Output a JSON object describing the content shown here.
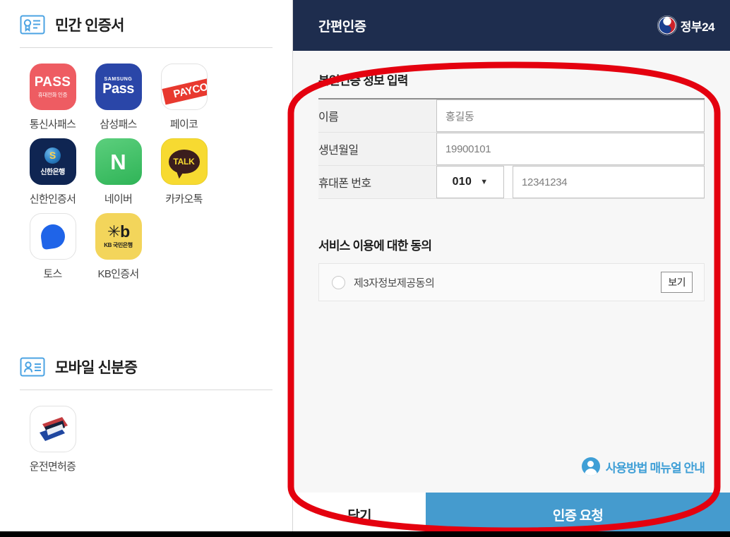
{
  "sidebar": {
    "sections": [
      {
        "icon": "certificate-icon",
        "title": "민간 인증서",
        "items": [
          {
            "name": "telecom-pass",
            "label": "통신사패스",
            "logo_main": "PASS",
            "logo_sub": "휴대전화 인증"
          },
          {
            "name": "samsung-pass",
            "label": "삼성패스",
            "logo_main": "Pass",
            "logo_sub": "SAMSUNG"
          },
          {
            "name": "payco",
            "label": "페이코",
            "logo_main": "PAYCO",
            "logo_sub": ""
          },
          {
            "name": "shinhan-cert",
            "label": "신한인증서",
            "logo_main": "신한은행",
            "logo_sub": ""
          },
          {
            "name": "naver",
            "label": "네이버",
            "logo_main": "N",
            "logo_sub": ""
          },
          {
            "name": "kakaotalk",
            "label": "카카오톡",
            "logo_main": "TALK",
            "logo_sub": ""
          },
          {
            "name": "toss",
            "label": "토스",
            "logo_main": "",
            "logo_sub": ""
          },
          {
            "name": "kb-cert",
            "label": "KB인증서",
            "logo_main": "Kb",
            "logo_sub": "KB 국민은행"
          }
        ]
      },
      {
        "icon": "id-card-icon",
        "title": "모바일 신분증",
        "items": [
          {
            "name": "drivers-license",
            "label": "운전면허증",
            "logo_main": "",
            "logo_sub": ""
          }
        ]
      }
    ]
  },
  "panel": {
    "header": {
      "title": "간편인증",
      "brand_text": "정부24",
      "brand_icon": "taegeuk-icon"
    },
    "form": {
      "title": "본인인증 정보 입력",
      "rows": [
        {
          "label": "이름",
          "placeholder": "홍길동",
          "value": ""
        },
        {
          "label": "생년월일",
          "placeholder": "19900101",
          "value": ""
        },
        {
          "label": "휴대폰 번호",
          "placeholder": "12341234",
          "value": "",
          "carrier": "010"
        }
      ]
    },
    "consent": {
      "title": "서비스 이용에 대한 동의",
      "item_label": "제3자정보제공동의",
      "view_button": "보기",
      "checked": false
    },
    "manual": {
      "text": "사용방법 매뉴얼 안내",
      "icon": "user-avatar-icon"
    },
    "footer": {
      "close_label": "닫기",
      "request_label": "인증 요청"
    }
  },
  "annotation": {
    "shape": "red-oval-highlight",
    "color": "#E4010F"
  },
  "colors": {
    "header_navy": "#1E2D4E",
    "primary_blue": "#459BCE",
    "annotation_red": "#E4010F",
    "label_bg": "#F2F2F2"
  }
}
